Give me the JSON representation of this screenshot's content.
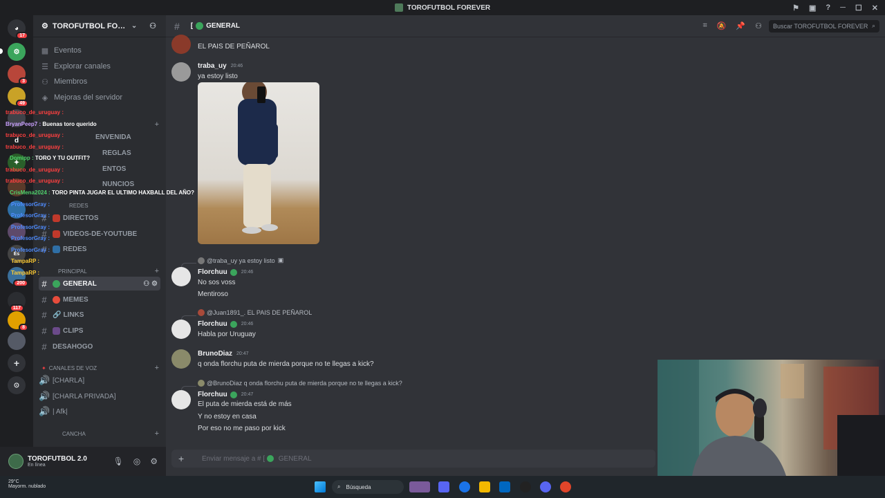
{
  "window": {
    "title": "TOROFUTBOL FOREVER"
  },
  "server": {
    "name": "TOROFUTBOL FOREVER",
    "rail_badges": [
      "17",
      "3",
      "49",
      "200",
      "117",
      "8"
    ]
  },
  "sidebar": {
    "top_items": [
      {
        "label": "Eventos",
        "icon": "calendar-icon"
      },
      {
        "label": "Explorar canales",
        "icon": "list-icon"
      },
      {
        "label": "Miembros",
        "icon": "members-icon"
      },
      {
        "label": "Mejoras del servidor",
        "icon": "boost-icon"
      }
    ],
    "partial_channels": [
      "ENVENIDA",
      "REGLAS",
      "ENTOS",
      "NUNCIOS"
    ],
    "category_redes": "REDES",
    "channels_redes": [
      "DIRECTOS",
      "VIDEOS-DE-YOUTUBE",
      "REDES"
    ],
    "category_principal": "PRINCIPAL",
    "channels_principal": [
      "GENERAL",
      "MEMES",
      "LINKS",
      "CLIPS",
      "DESAHOGO"
    ],
    "category_voz": "CANALES DE VOZ",
    "voice_channels": [
      "[CHARLA]",
      "[CHARLA PRIVADA]",
      "| Afk|"
    ],
    "category_cancha": "CANCHA"
  },
  "user_panel": {
    "name": "TOROFUTBOL 2.0",
    "status": "En línea"
  },
  "overlay_chat": [
    {
      "user": "trabuco_de_uruguay :",
      "msg": "",
      "color": "#ff4040"
    },
    {
      "user": "BryanPeep7 :",
      "msg": "Buenas toro querido",
      "color": "#c9a0ff"
    },
    {
      "user": "trabuco_de_uruguay :",
      "msg": "",
      "color": "#ff4040"
    },
    {
      "user": "trabuco_de_uruguay :",
      "msg": "",
      "color": "#ff4040"
    },
    {
      "user": "Domipp :",
      "msg": "TORO Y TU OUTFIT?",
      "color": "#4fd16b"
    },
    {
      "user": "trabuco_de_uruguay :",
      "msg": "",
      "color": "#ff4040"
    },
    {
      "user": "trabuco_de_uruguay :",
      "msg": "",
      "color": "#ff4040"
    },
    {
      "user": "CrisMena2024 :",
      "msg": "TORO PINTA JUGAR EL ULTIMO HAXBALL DEL AÑO?",
      "color": "#4fd16b"
    },
    {
      "user": "ProfesorGray :",
      "msg": "",
      "color": "#4f8cff"
    },
    {
      "user": "ProfesorGray :",
      "msg": "",
      "color": "#4f8cff"
    },
    {
      "user": "ProfesorGray :",
      "msg": "",
      "color": "#4f8cff"
    },
    {
      "user": "ProfesorGray :",
      "msg": "",
      "color": "#4f8cff"
    },
    {
      "user": "ProfesorGray :",
      "msg": "",
      "color": "#4f8cff"
    },
    {
      "user": "TampaRP :",
      "msg": "",
      "color": "#ffcc33"
    },
    {
      "user": "TampaRP :",
      "msg": "",
      "color": "#ffcc33"
    }
  ],
  "channel_header": {
    "channel_name": "GENERAL",
    "search_placeholder": "Buscar TOROFUTBOL FOREVER"
  },
  "messages": {
    "m0_line": "EL PAIS DE PEÑAROL",
    "m1_user": "traba_uy",
    "m1_time": "20:46",
    "m1_line": "ya estoy listo",
    "m2_reply": "@traba_uy ya estoy listo",
    "m2_user": "Florchuu",
    "m2_time": "20:46",
    "m2_lines": [
      "No sos voss",
      "Mentiroso"
    ],
    "m3_reply": "@Juan1891_. EL PAIS DE PEÑAROL",
    "m3_user": "Florchuu",
    "m3_time": "20:46",
    "m3_line": "Habla por Uruguay",
    "m4_user": "BrunoDiaz",
    "m4_time": "20:47",
    "m4_line": "q onda florchu puta de mierda porque no te llegas a kick?",
    "m5_reply": "@BrunoDiaz q onda florchu puta de mierda porque no te llegas a kick?",
    "m5_user": "Florchuu",
    "m5_time": "20:47",
    "m5_lines": [
      "El puta de mierda está de más",
      "Y no estoy en casa",
      "Por eso no me paso por kick"
    ]
  },
  "composer": {
    "placeholder_prefix": "Enviar mensaje a #",
    "channel": "GENERAL"
  },
  "taskbar": {
    "temp": "29°C",
    "weather": "Mayorm. nublado",
    "search": "Búsqueda"
  },
  "colors": {
    "accent_green": "#3ba55c",
    "unread_red": "#f23f43"
  }
}
